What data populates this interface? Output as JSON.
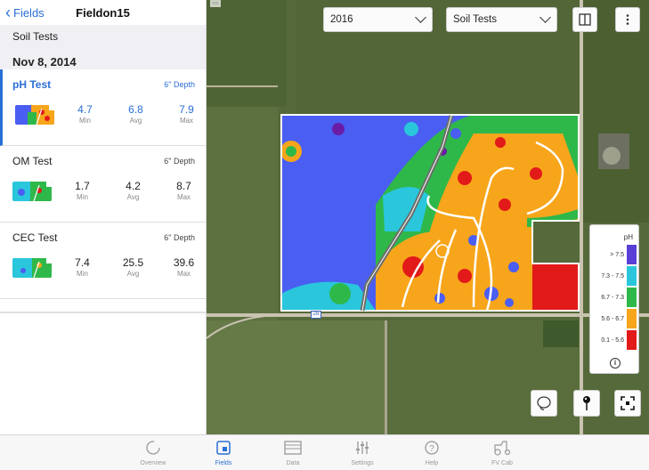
{
  "nav": {
    "back_label": "Fields",
    "title": "Fieldon15"
  },
  "panel": {
    "section_title": "Soil Tests",
    "date": "Nov 8, 2014",
    "tests": [
      {
        "name": "pH Test",
        "depth": "6\" Depth",
        "min": "4.7",
        "avg": "6.8",
        "max": "7.9",
        "min_label": "Min",
        "avg_label": "Avg",
        "max_label": "Max",
        "active": true
      },
      {
        "name": "OM Test",
        "depth": "6\" Depth",
        "min": "1.7",
        "avg": "4.2",
        "max": "8.7",
        "min_label": "Min",
        "avg_label": "Avg",
        "max_label": "Max",
        "active": false
      },
      {
        "name": "CEC Test",
        "depth": "6\" Depth",
        "min": "7.4",
        "avg": "25.5",
        "max": "39.6",
        "min_label": "Min",
        "avg_label": "Avg",
        "max_label": "Max",
        "active": false
      }
    ]
  },
  "map": {
    "year_select": "2016",
    "layer_select": "Soil Tests",
    "route_label": "28",
    "legend": {
      "title": "pH",
      "rows": [
        {
          "label": "> 7.5",
          "color": "#5a3fd6"
        },
        {
          "label": "7.3 - 7.5",
          "color": "#29c6dc"
        },
        {
          "label": "6.7 - 7.3",
          "color": "#2fb84a"
        },
        {
          "label": "5.6 - 6.7",
          "color": "#f7a51b"
        },
        {
          "label": "0.1 - 5.6",
          "color": "#e21a1a"
        }
      ]
    },
    "icons": [
      "panel-toggle-icon",
      "more-vert-icon",
      "lasso-icon",
      "pin-icon",
      "focus-icon",
      "info-icon"
    ]
  },
  "tabs": [
    {
      "label": "Overview",
      "icon": "overview-icon",
      "active": false
    },
    {
      "label": "Fields",
      "icon": "fields-icon",
      "active": true
    },
    {
      "label": "Data",
      "icon": "data-icon",
      "active": false
    },
    {
      "label": "Settings",
      "icon": "settings-icon",
      "active": false
    },
    {
      "label": "Help",
      "icon": "help-icon",
      "active": false
    },
    {
      "label": "FV Cab",
      "icon": "tractor-icon",
      "active": false
    }
  ],
  "colors": {
    "accent": "#2a6fd6"
  }
}
